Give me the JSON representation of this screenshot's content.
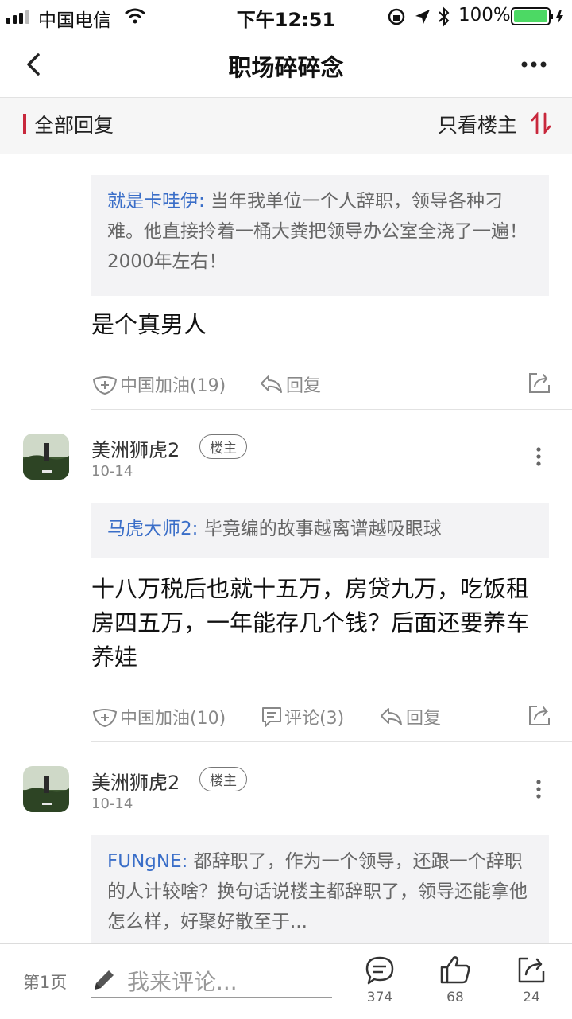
{
  "status_bar": {
    "carrier": "中国电信",
    "time": "下午12:51",
    "battery": "100%",
    "battery_color": "#4cd964"
  },
  "nav": {
    "title": "职场碎碎念"
  },
  "filter": {
    "all_replies": "全部回复",
    "owner_only": "只看楼主",
    "accent_color": "#c8283c"
  },
  "posts": [
    {
      "quote_name": "就是卡哇伊:",
      "quote_text": " 当年我单位一个人辞职，领导各种刁难。他直接拎着一桶大粪把领导办公室全浇了一遍！2000年左右！",
      "body": "是个真男人",
      "cheer": "中国加油(19)",
      "reply": "回复"
    },
    {
      "author": "美洲狮虎2",
      "badge": "楼主",
      "date": "10-14",
      "quote_name": "马虎大师2:",
      "quote_text": " 毕竟编的故事越离谱越吸眼球",
      "body": "十八万税后也就十五万，房贷九万，吃饭租房四五万，一年能存几个钱？后面还要养车养娃",
      "cheer": "中国加油(10)",
      "comments": "评论(3)",
      "reply": "回复"
    },
    {
      "author": "美洲狮虎2",
      "badge": "楼主",
      "date": "10-14",
      "quote_name": "FUNgNE:",
      "quote_text": " 都辞职了，作为一个领导，还跟一个辞职的人计较啥？换句话说楼主都辞职了，领导还能拿他怎么样，好聚好散至于..."
    }
  ],
  "bottom": {
    "page": "第1页",
    "comment_placeholder": "我来评论...",
    "comment_count": "374",
    "like_count": "68",
    "share_count": "24"
  },
  "colors": {
    "link_blue": "#3a6ec8"
  }
}
